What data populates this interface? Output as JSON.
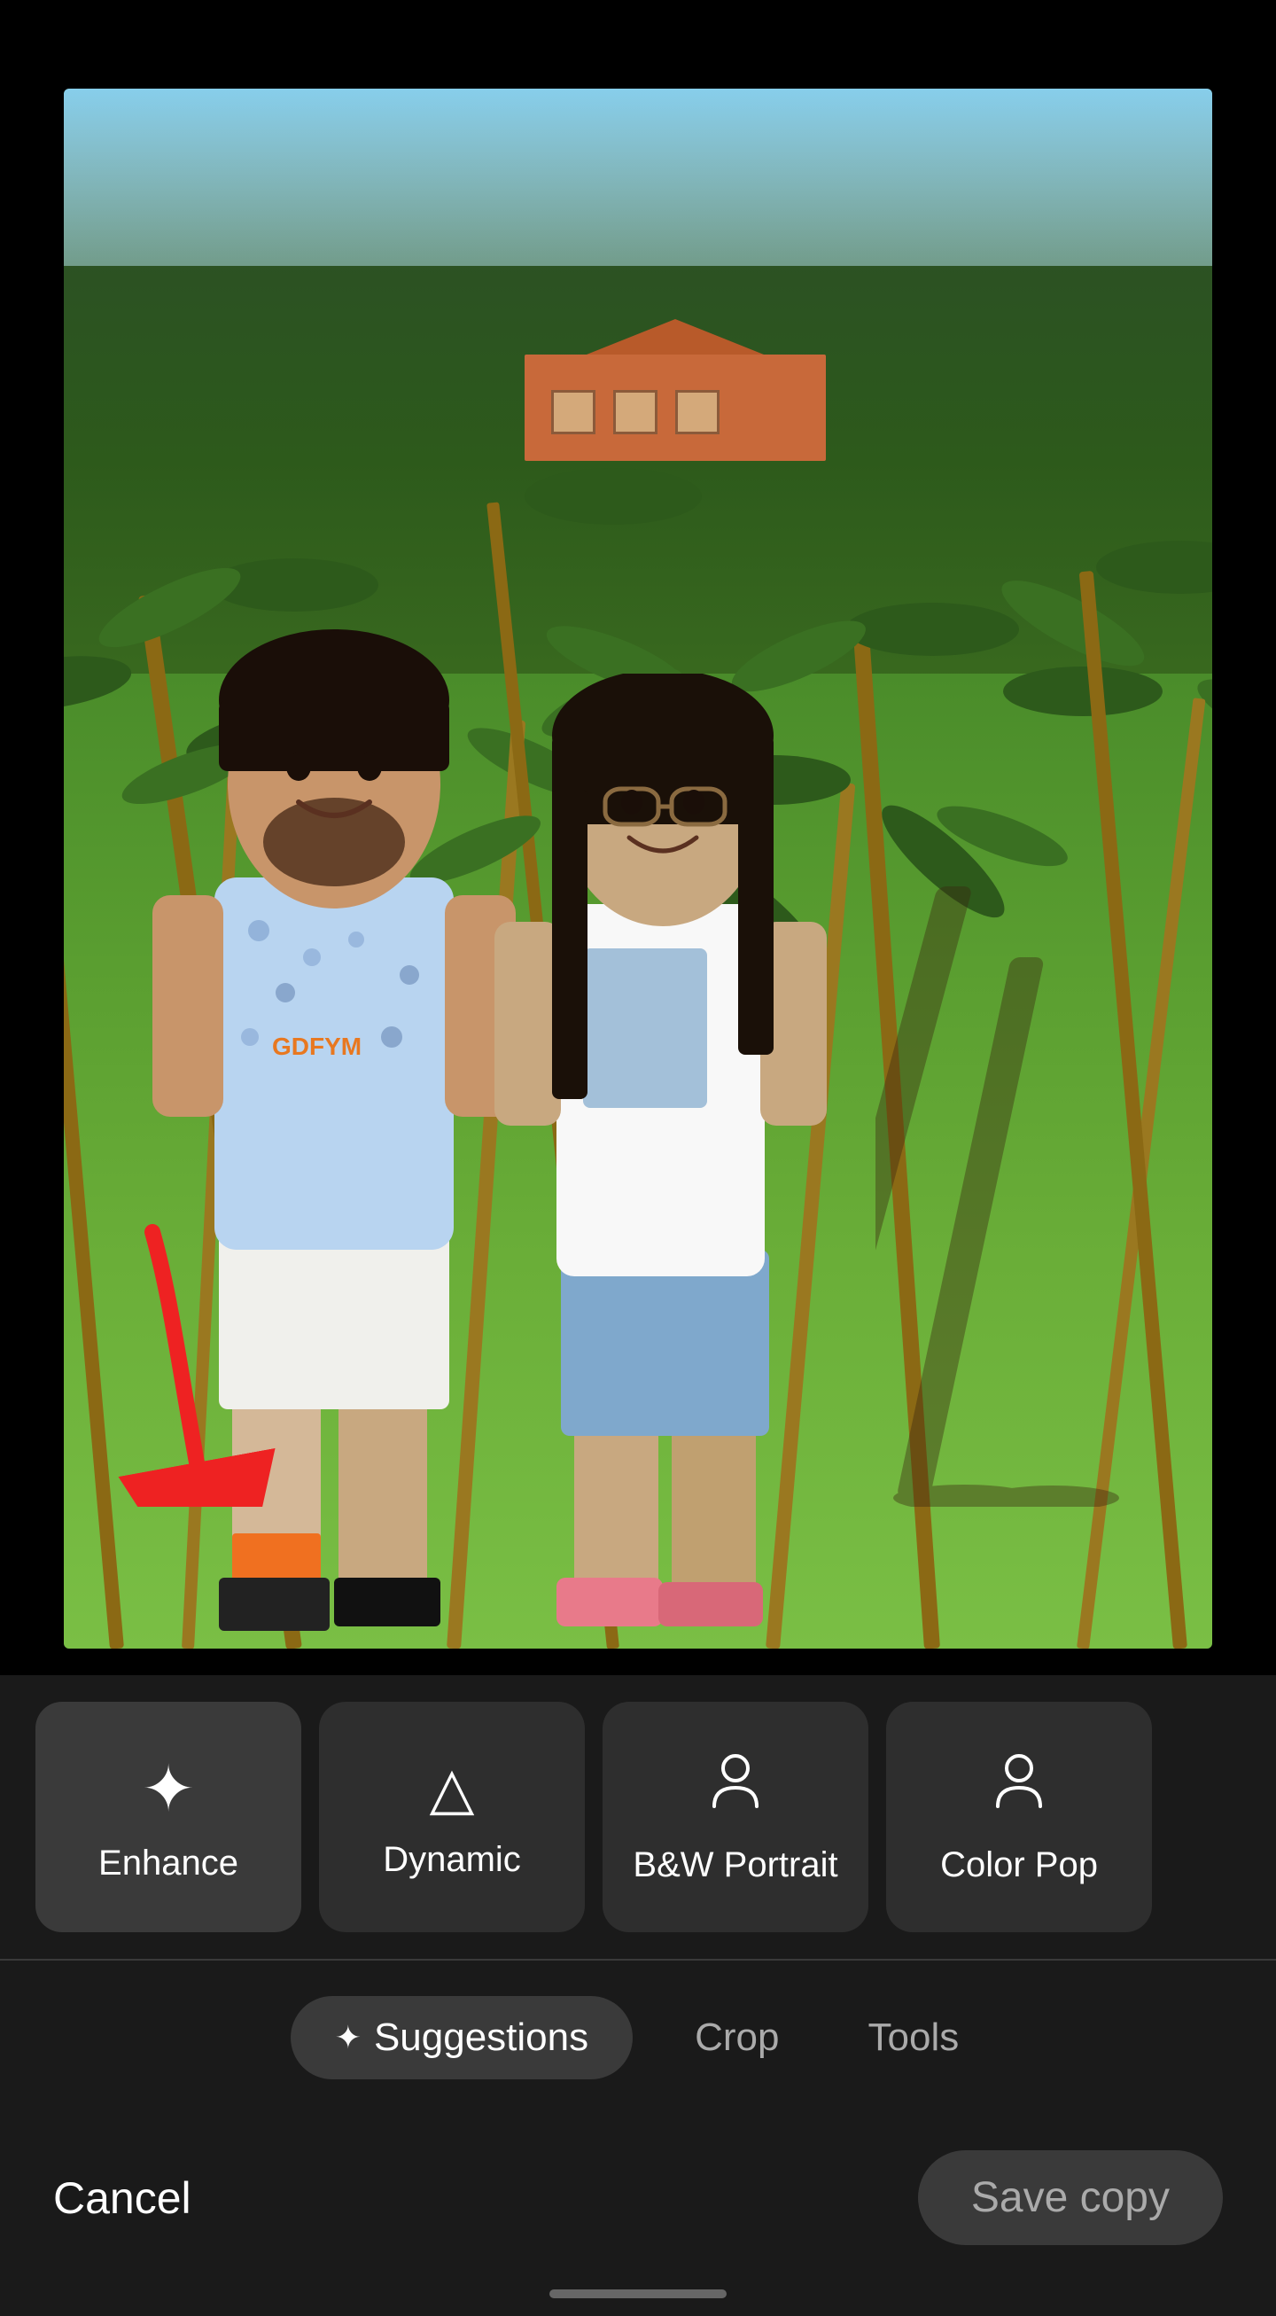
{
  "photo": {
    "alt": "Couple standing on grass with palm trees"
  },
  "filters": [
    {
      "id": "enhance",
      "label": "Enhance",
      "icon": "✦"
    },
    {
      "id": "dynamic",
      "label": "Dynamic",
      "icon": "△"
    },
    {
      "id": "bw-portrait",
      "label": "B&W Portrait",
      "icon": "👤"
    },
    {
      "id": "color-pop",
      "label": "Color Pop",
      "icon": "👤"
    }
  ],
  "nav": {
    "tabs": [
      {
        "id": "suggestions",
        "label": "Suggestions",
        "active": true
      },
      {
        "id": "crop",
        "label": "Crop",
        "active": false
      },
      {
        "id": "tools",
        "label": "Tools",
        "active": false
      }
    ],
    "suggestions_sparkle": "✦"
  },
  "actions": {
    "cancel": "Cancel",
    "save_copy": "Save copy"
  }
}
